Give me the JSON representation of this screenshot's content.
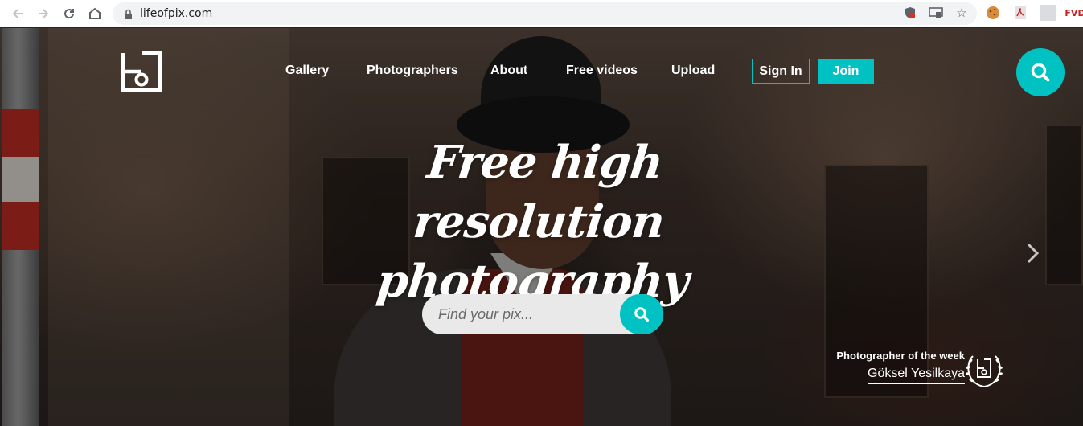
{
  "browser": {
    "url": "lifeofpix.com",
    "icons": [
      "back-icon",
      "forward-icon",
      "reload-icon",
      "home-icon",
      "lock-icon",
      "blocked-content-icon",
      "cast-icon",
      "star-icon",
      "cookie-extension-icon",
      "pdf-extension-icon",
      "fvd-extension-icon"
    ],
    "extension_label": "FVD"
  },
  "site": {
    "accent_color": "#00c2c2",
    "nav": {
      "gallery": "Gallery",
      "photographers": "Photographers",
      "about": "About",
      "free_videos": "Free videos",
      "upload": "Upload"
    },
    "sign_in": "Sign In",
    "join": "Join"
  },
  "hero": {
    "headline_line1": "Free high resolution",
    "headline_line2": "photography",
    "search_placeholder": "Find your pix..."
  },
  "photographer_of_week": {
    "label": "Photographer of the week",
    "name": "Göksel Yesilkaya"
  }
}
